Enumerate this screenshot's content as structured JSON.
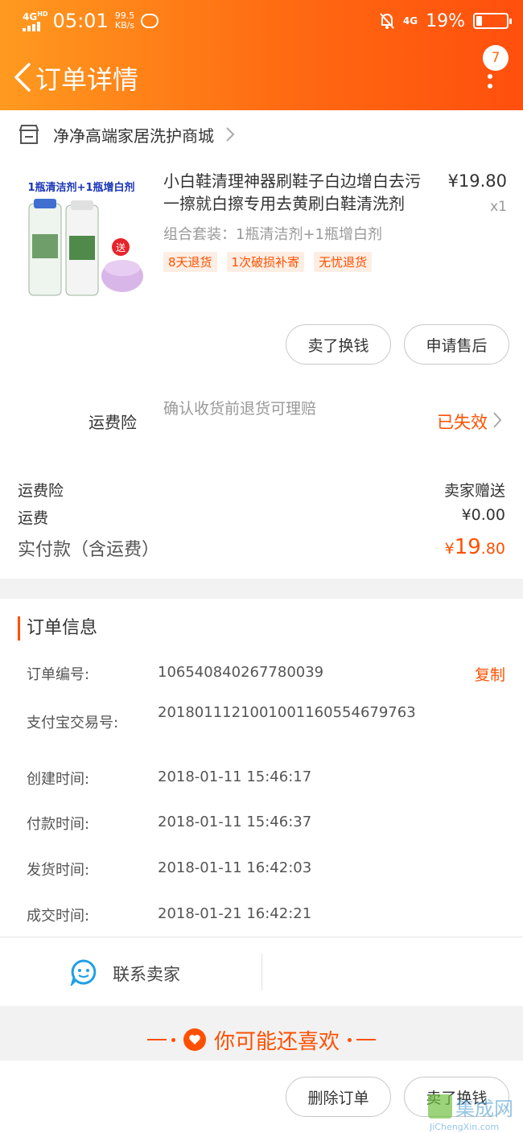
{
  "status_bar": {
    "network": "4G",
    "network_sup": "HD",
    "time": "05:01",
    "speed_value": "99.5",
    "speed_unit": "KB/s",
    "network_right": "4G",
    "battery": "19%",
    "battery_level": 0.19
  },
  "header": {
    "title": "订单详情",
    "badge_count": "7"
  },
  "shop": {
    "name": "净净高端家居洗护商城"
  },
  "product": {
    "image_banner": "1瓶清洁剂+1瓶增白剂",
    "image_badge": "送",
    "title": "小白鞋清理神器刷鞋子白边增白去污一擦就白擦专用去黄刷白鞋清洗剂",
    "price": "¥19.80",
    "qty": "x1",
    "sku": "组合套装：1瓶清洁剂+1瓶增白剂",
    "tags": [
      "8天退货",
      "1次破损补寄",
      "无忧退货"
    ]
  },
  "actions": {
    "sell_label": "卖了换钱",
    "after_sale_label": "申请售后"
  },
  "insurance": {
    "label": "运费险",
    "desc": "确认收货前退货可理赔",
    "status": "已失效"
  },
  "summary": {
    "ins_label": "运费险",
    "ins_value": "卖家赠送",
    "ship_label": "运费",
    "ship_value": "¥0.00",
    "pay_label": "实付款（含运费）",
    "pay_yen": "¥",
    "pay_int": "19",
    "pay_dec": ".80"
  },
  "order_info": {
    "heading": "订单信息",
    "copy_label": "复制",
    "rows": [
      {
        "key": "订单编号:",
        "value": "106540840267780039"
      },
      {
        "key": "支付宝交易号:",
        "value": "2018011121001001160554679763"
      },
      {
        "key": "创建时间:",
        "value": "2018-01-11 15:46:17"
      },
      {
        "key": "付款时间:",
        "value": "2018-01-11 15:46:37"
      },
      {
        "key": "发货时间:",
        "value": "2018-01-11 16:42:03"
      },
      {
        "key": "成交时间:",
        "value": "2018-01-21 16:42:21"
      }
    ]
  },
  "contact": {
    "label": "联系卖家"
  },
  "recommend": {
    "label": "你可能还喜欢"
  },
  "bottom": {
    "delete_label": "删除订单",
    "sell_label": "卖了换钱"
  },
  "watermark": {
    "text": "集成网",
    "url_text": "JiChengXin.com"
  },
  "colors": {
    "accent": "#ff5000",
    "header_start": "#ff9a1f",
    "header_end": "#ff4f0d"
  }
}
